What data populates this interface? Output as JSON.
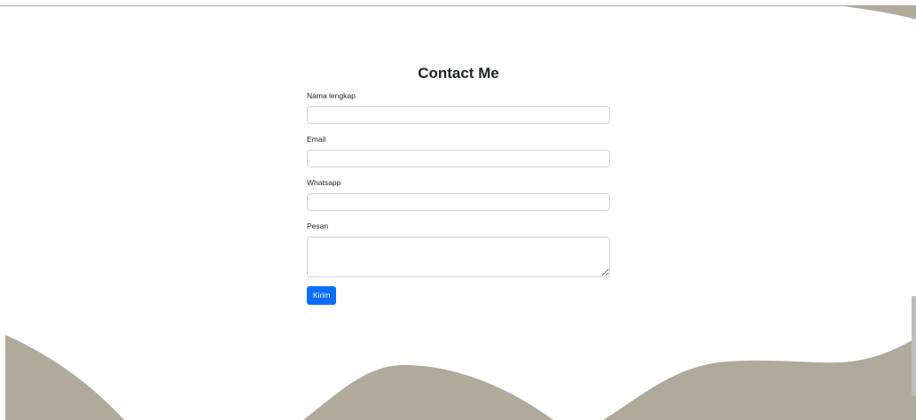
{
  "form": {
    "title": "Contact Me",
    "fields": [
      {
        "label": "Nama lengkap",
        "value": "",
        "placeholder": ""
      },
      {
        "label": "Email",
        "value": "",
        "placeholder": ""
      },
      {
        "label": "Whatsapp",
        "value": "",
        "placeholder": ""
      },
      {
        "label": "Pesan",
        "value": "",
        "placeholder": ""
      }
    ],
    "submit_label": "Kirim"
  },
  "colors": {
    "wave": "#b0aa9d",
    "button": "#0d6efd",
    "input_border": "#ced4da"
  }
}
